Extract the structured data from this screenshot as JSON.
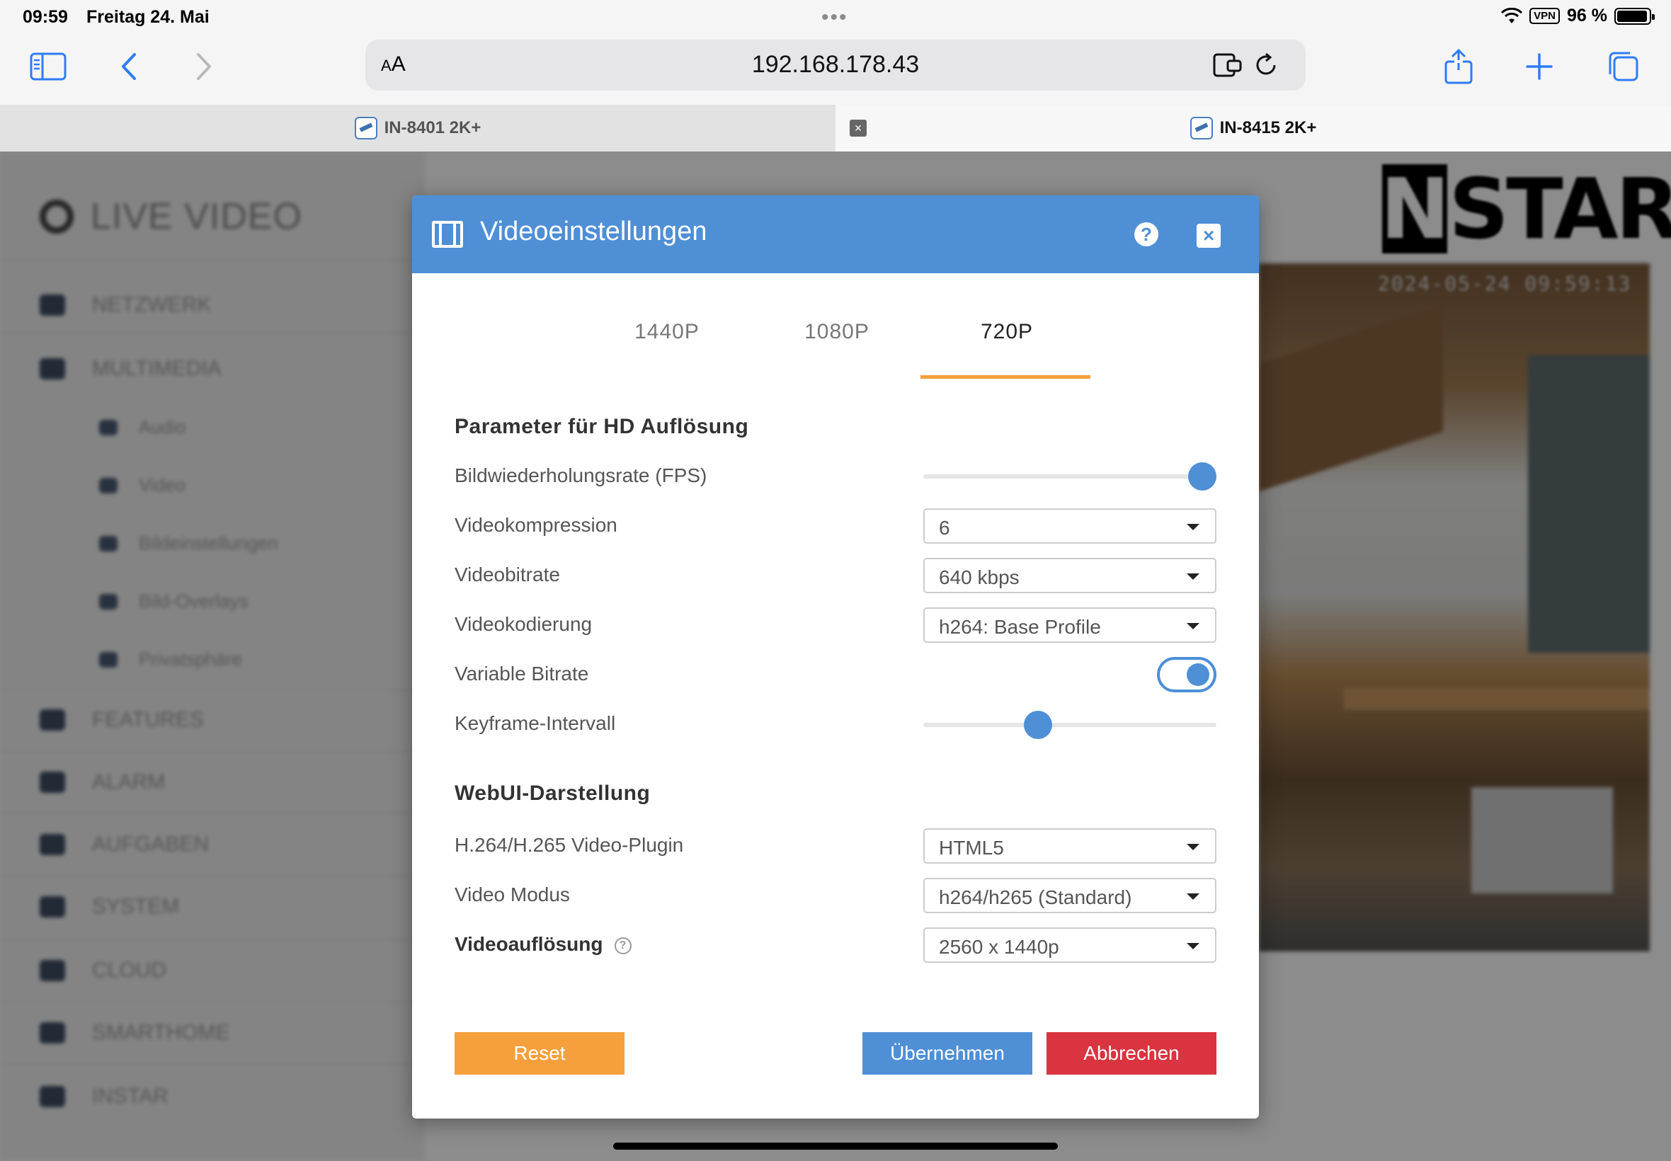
{
  "status_bar": {
    "time": "09:59",
    "date": "Freitag 24. Mai",
    "vpn": "VPN",
    "battery": "96 %",
    "battery_level": 0.96
  },
  "browser": {
    "text_size_label": "AA",
    "url": "192.168.178.43",
    "tabs": [
      {
        "title": "IN-8401 2K+",
        "active": false
      },
      {
        "title": "IN-8415 2K+",
        "active": true
      }
    ]
  },
  "background_app": {
    "sidebar_title": "LIVE VIDEO",
    "nav": [
      {
        "label": "NETZWERK",
        "level": 1
      },
      {
        "label": "MULTIMEDIA",
        "level": 1
      },
      {
        "label": "Audio",
        "level": 2
      },
      {
        "label": "Video",
        "level": 2
      },
      {
        "label": "Bildeinstellungen",
        "level": 2
      },
      {
        "label": "Bild-Overlays",
        "level": 2
      },
      {
        "label": "Privatsphäre",
        "level": 2
      },
      {
        "label": "FEATURES",
        "level": 1
      },
      {
        "label": "ALARM",
        "level": 1
      },
      {
        "label": "AUFGABEN",
        "level": 1
      },
      {
        "label": "SYSTEM",
        "level": 1
      },
      {
        "label": "CLOUD",
        "level": 1
      },
      {
        "label": "SMARTHOME",
        "level": 1
      },
      {
        "label": "INSTAR",
        "level": 1
      }
    ],
    "logo_text_a": "IN",
    "logo_text_b": "STAR",
    "camera_timestamp": "2024-05-24 09:59:13"
  },
  "modal": {
    "title": "Videoeinstellungen",
    "tabs": [
      "1440P",
      "1080P",
      "720P"
    ],
    "active_tab": "720P",
    "section_hd": "Parameter für HD Auflösung",
    "fps": {
      "label": "Bildwiederholungsrate (FPS)",
      "value_fraction": 1.0
    },
    "compression": {
      "label": "Videokompression",
      "value": "6"
    },
    "bitrate": {
      "label": "Videobitrate",
      "value": "640 kbps"
    },
    "encoding": {
      "label": "Videokodierung",
      "value": "h264: Base Profile"
    },
    "variable_bitrate": {
      "label": "Variable Bitrate",
      "on": true
    },
    "keyframe": {
      "label": "Keyframe-Intervall",
      "value_fraction": 0.38
    },
    "section_webui": "WebUI-Darstellung",
    "plugin": {
      "label": "H.264/H.265 Video-Plugin",
      "value": "HTML5"
    },
    "mode": {
      "label": "Video Modus",
      "value": "h264/h265 (Standard)"
    },
    "resolution": {
      "label": "Videoauflösung",
      "value": "2560 x 1440p"
    },
    "buttons": {
      "reset": "Reset",
      "apply": "Übernehmen",
      "cancel": "Abbrechen"
    }
  },
  "colors": {
    "header_blue": "#4e8fd6",
    "reset_orange": "#f5a03c",
    "cancel_red": "#d9343f",
    "tab_underline": "#f5a03c"
  }
}
